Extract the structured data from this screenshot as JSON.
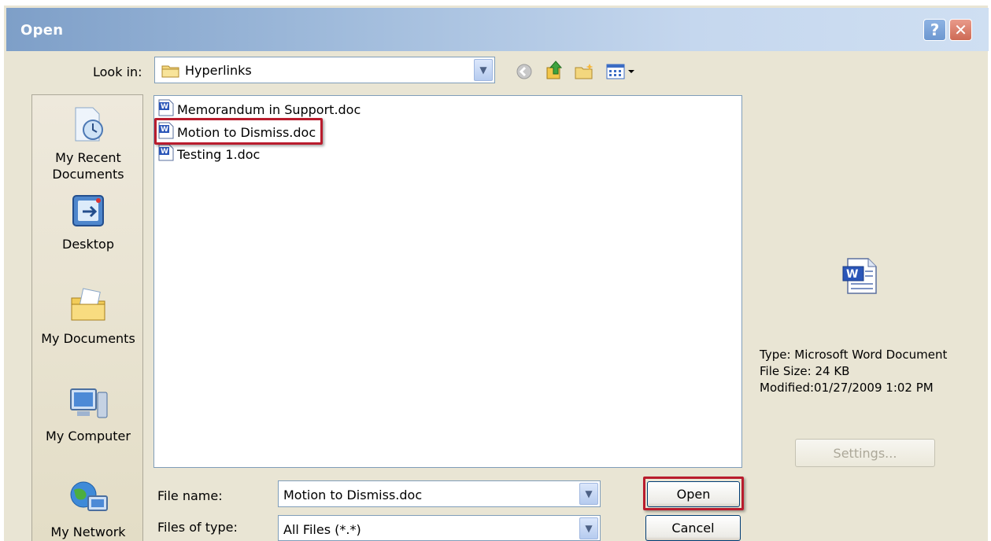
{
  "window": {
    "title": "Open",
    "help_glyph": "?",
    "close_glyph": "✕"
  },
  "lookin": {
    "label": "Look in:",
    "value": "Hyperlinks"
  },
  "toolbar": {
    "icons": [
      "back-icon",
      "up-folder-icon",
      "new-folder-icon",
      "views-menu-icon"
    ]
  },
  "places": [
    {
      "label_line1": "My Recent",
      "label_line2": "Documents",
      "icon": "recent-documents-icon"
    },
    {
      "label_line1": "Desktop",
      "label_line2": "",
      "icon": "desktop-icon"
    },
    {
      "label_line1": "My Documents",
      "label_line2": "",
      "icon": "my-documents-icon"
    },
    {
      "label_line1": "My Computer",
      "label_line2": "",
      "icon": "my-computer-icon"
    },
    {
      "label_line1": "My Network",
      "label_line2": "",
      "icon": "my-network-icon"
    }
  ],
  "files": [
    {
      "name": "Memorandum in Support.doc"
    },
    {
      "name": "Motion to Dismiss.doc"
    },
    {
      "name": "Testing 1.doc"
    }
  ],
  "preview": {
    "type": "Type: Microsoft Word Document",
    "size": "File Size: 24 KB",
    "modified": "Modified:01/27/2009 1:02 PM",
    "settings_label": "Settings..."
  },
  "form": {
    "file_name_label": "File name:",
    "file_name_value": "Motion to Dismiss.doc",
    "file_type_label": "Files of type:",
    "file_type_value": "All Files (*.*)",
    "open_label": "Open",
    "cancel_label": "Cancel"
  },
  "colors": {
    "highlight": "#b91c2d",
    "dialog_bg": "#e9e5d4"
  }
}
